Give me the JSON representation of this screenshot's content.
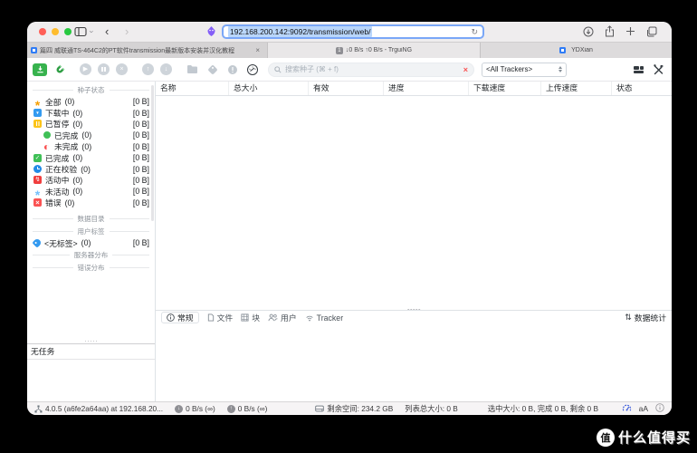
{
  "browser": {
    "url": "192.168.200.142:9092/transmission/web/",
    "tabs": [
      {
        "title": "篇四 威联通TS-464C2的PT软件transmission最新版本安装并汉化教程",
        "close": "×"
      },
      {
        "badge": "1",
        "title": "↓0 B/s ↑0 B/s - TrguiNG"
      },
      {
        "title": "YDXian"
      }
    ]
  },
  "toolbar": {
    "search_placeholder": "搜索种子 (⌘ + f)",
    "clear_search": "×",
    "tracker_filter": "<All Trackers>"
  },
  "sidebar": {
    "sections": {
      "status": "种子状态",
      "directories": "数据目录",
      "labels": "用户标签",
      "servers": "服务器分布",
      "errors": "错误分布"
    },
    "items": [
      {
        "icon": "asterisk-icon",
        "label": "全部",
        "count": "(0)",
        "size": "[0 B]"
      },
      {
        "icon": "download-icon",
        "label": "下载中",
        "count": "(0)",
        "size": "[0 B]"
      },
      {
        "icon": "pause-icon",
        "label": "已暂停",
        "count": "(0)",
        "size": "[0 B]"
      },
      {
        "icon": "done-dot-icon",
        "label": "已完成",
        "count": "(0)",
        "size": "[0 B]"
      },
      {
        "icon": "half-dot-icon",
        "label": "未完成",
        "count": "(0)",
        "size": "[0 B]"
      },
      {
        "icon": "completed-icon",
        "label": "已完成",
        "count": "(0)",
        "size": "[0 B]"
      },
      {
        "icon": "verifying-icon",
        "label": "正在校验",
        "count": "(0)",
        "size": "[0 B]"
      },
      {
        "icon": "active-icon",
        "label": "活动中",
        "count": "(0)",
        "size": "[0 B]"
      },
      {
        "icon": "inactive-icon",
        "label": "未活动",
        "count": "(0)",
        "size": "[0 B]"
      },
      {
        "icon": "error-icon",
        "label": "错误",
        "count": "(0)",
        "size": "[0 B]"
      }
    ],
    "label_item": {
      "label": "<无标签>",
      "count": "(0)",
      "size": "[0 B]"
    }
  },
  "table": {
    "headers": [
      "名称",
      "总大小",
      "有效",
      "进度",
      "下载速度",
      "上传速度",
      "状态"
    ]
  },
  "details": {
    "tabs": [
      "常规",
      "文件",
      "块",
      "用户",
      "Tracker"
    ],
    "stats": "数据统计"
  },
  "tasks": {
    "empty": "无任务"
  },
  "statusbar": {
    "version": "4.0.5 (a6fe2a64aa) at 192.168.20...",
    "down_speed": "0 B/s (∞)",
    "up_speed": "0 B/s (∞)",
    "free_space": "剩余空间: 234.2 GB",
    "list_total": "列表总大小: 0 B",
    "selection": "选中大小: 0 B, 完成 0 B, 剩余 0 B",
    "font_size_label": "aA"
  },
  "watermark": {
    "logo": "值",
    "text": "什么值得买"
  },
  "colors": {
    "accent_blue": "#7aa7f7",
    "green": "#37b24d",
    "error_red": "#fa5252",
    "selection_highlight": "#b9d6fb"
  }
}
